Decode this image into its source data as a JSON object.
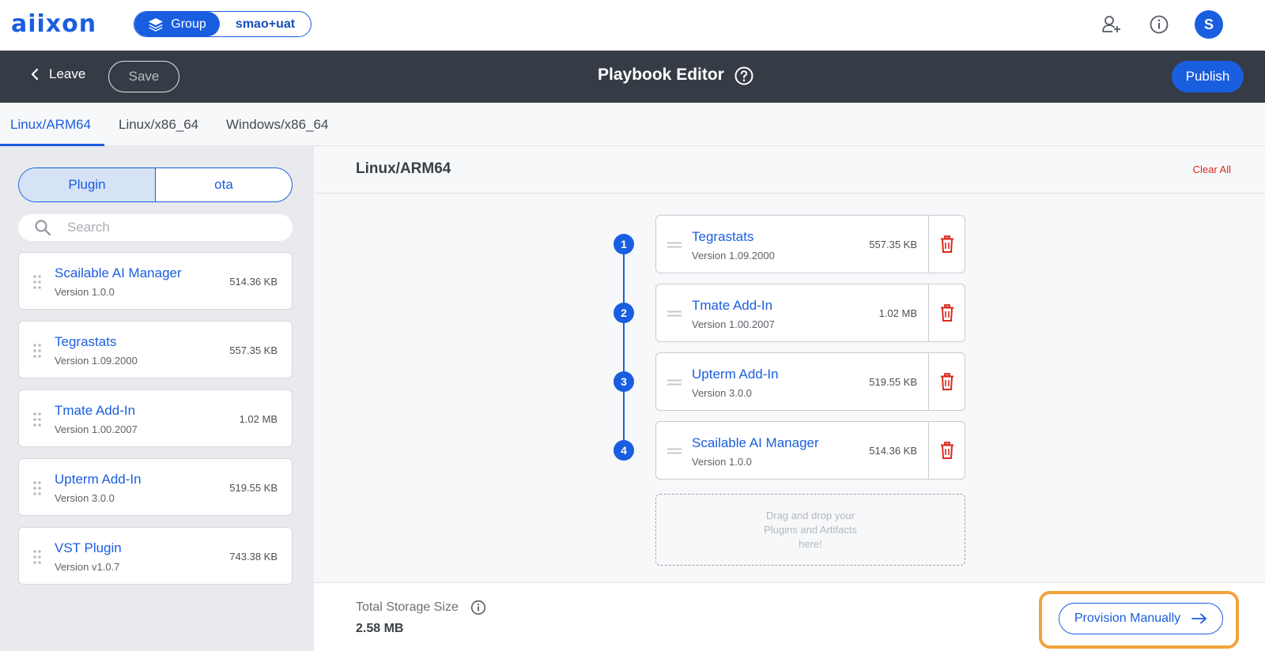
{
  "app": {
    "logo_text": "aiixon",
    "context_group_label": "Group",
    "context_user_label": "smao+uat",
    "avatar_initial": "S",
    "accent_color": "#1a5ee0"
  },
  "editor_bar": {
    "leave_label": "Leave",
    "save_label": "Save",
    "title": "Playbook Editor",
    "publish_label": "Publish"
  },
  "tabs": [
    {
      "label": "Linux/ARM64",
      "active": true
    },
    {
      "label": "Linux/x86_64",
      "active": false
    },
    {
      "label": "Windows/x86_64",
      "active": false
    }
  ],
  "library": {
    "type_toggle": {
      "plugin_label": "Plugin",
      "ota_label": "ota",
      "selected": "Plugin"
    },
    "search_placeholder": "Search",
    "items": [
      {
        "name": "Scailable AI Manager",
        "version": "Version 1.0.0",
        "size": "514.36 KB"
      },
      {
        "name": "Tegrastats",
        "version": "Version 1.09.2000",
        "size": "557.35 KB"
      },
      {
        "name": "Tmate Add-In",
        "version": "Version 1.00.2007",
        "size": "1.02 MB"
      },
      {
        "name": "Upterm Add-In",
        "version": "Version 3.0.0",
        "size": "519.55 KB"
      },
      {
        "name": "VST Plugin",
        "version": "Version v1.0.7",
        "size": "743.38 KB"
      }
    ]
  },
  "playbook": {
    "platform_title": "Linux/ARM64",
    "clear_all_label": "Clear All",
    "steps": [
      {
        "number": "1",
        "name": "Tegrastats",
        "version": "Version 1.09.2000",
        "size": "557.35 KB"
      },
      {
        "number": "2",
        "name": "Tmate Add-In",
        "version": "Version 1.00.2007",
        "size": "1.02 MB"
      },
      {
        "number": "3",
        "name": "Upterm Add-In",
        "version": "Version 3.0.0",
        "size": "519.55 KB"
      },
      {
        "number": "4",
        "name": "Scailable AI Manager",
        "version": "Version 1.0.0",
        "size": "514.36 KB"
      }
    ],
    "dropzone_text": "Drag and drop your Plugins and Artifacts here!",
    "storage_label": "Total Storage Size",
    "storage_value": "2.58 MB",
    "provision_label": "Provision Manually"
  }
}
